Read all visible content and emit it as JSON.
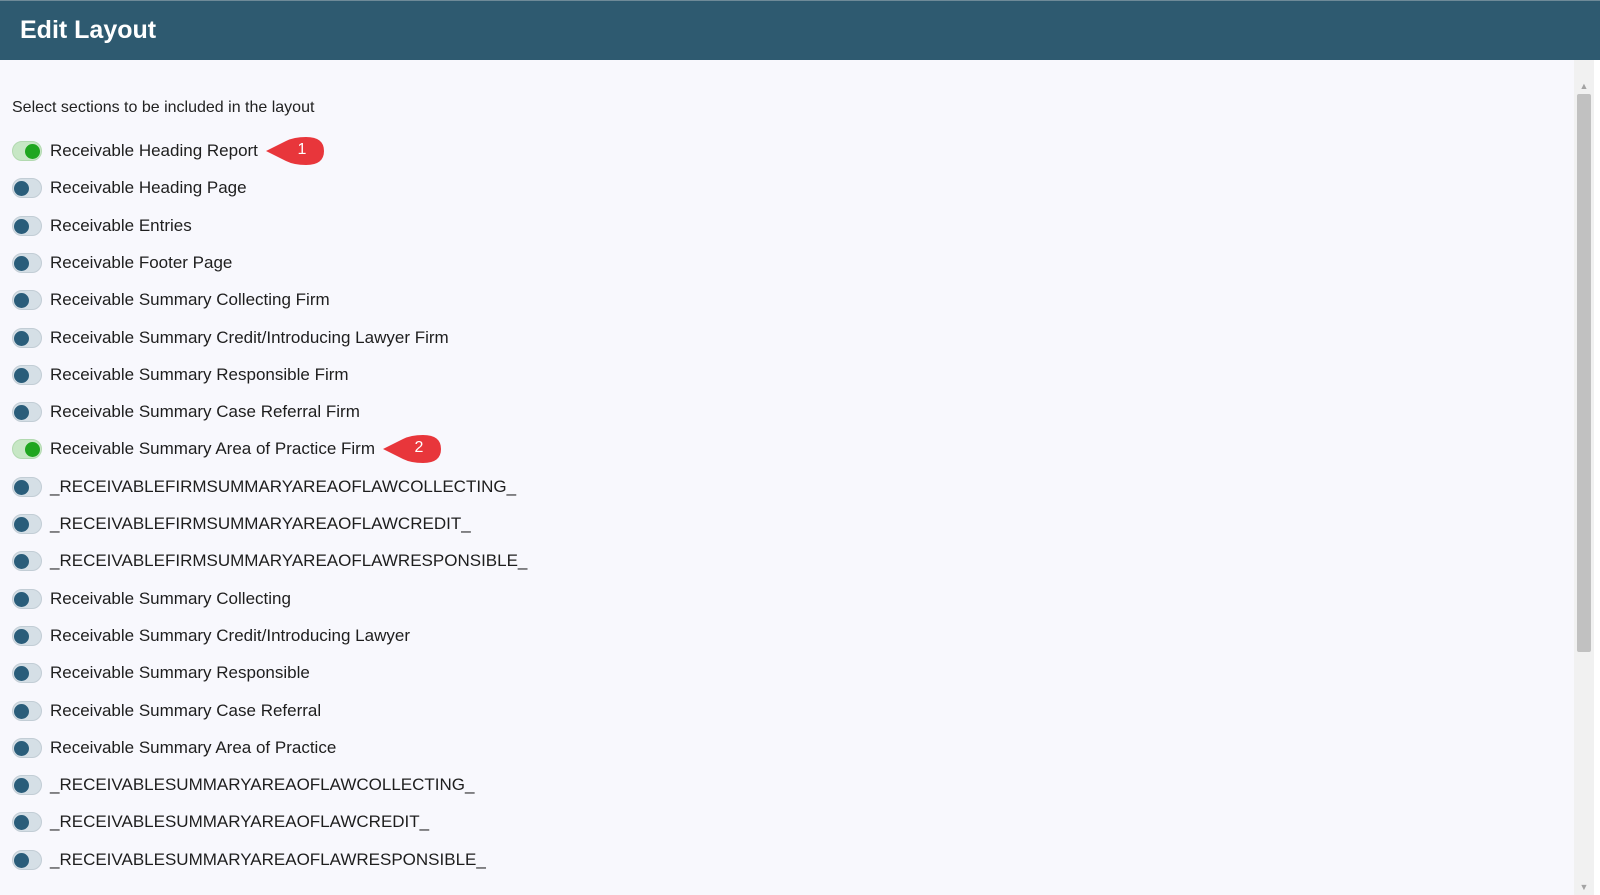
{
  "header": {
    "title": "Edit Layout"
  },
  "instruction": "Select sections to be included in the layout",
  "sections": [
    {
      "label": "Receivable Heading Report",
      "enabled": true
    },
    {
      "label": "Receivable Heading Page",
      "enabled": false
    },
    {
      "label": "Receivable Entries",
      "enabled": false
    },
    {
      "label": "Receivable Footer Page",
      "enabled": false
    },
    {
      "label": "Receivable Summary Collecting Firm",
      "enabled": false
    },
    {
      "label": "Receivable Summary Credit/Introducing Lawyer Firm",
      "enabled": false
    },
    {
      "label": "Receivable Summary Responsible Firm",
      "enabled": false
    },
    {
      "label": "Receivable Summary Case Referral Firm",
      "enabled": false
    },
    {
      "label": "Receivable Summary Area of Practice Firm",
      "enabled": true
    },
    {
      "label": "_RECEIVABLEFIRMSUMMARYAREAOFLAWCOLLECTING_",
      "enabled": false
    },
    {
      "label": "_RECEIVABLEFIRMSUMMARYAREAOFLAWCREDIT_",
      "enabled": false
    },
    {
      "label": "_RECEIVABLEFIRMSUMMARYAREAOFLAWRESPONSIBLE_",
      "enabled": false
    },
    {
      "label": "Receivable Summary Collecting",
      "enabled": false
    },
    {
      "label": "Receivable Summary Credit/Introducing Lawyer",
      "enabled": false
    },
    {
      "label": "Receivable Summary Responsible",
      "enabled": false
    },
    {
      "label": "Receivable Summary Case Referral",
      "enabled": false
    },
    {
      "label": "Receivable Summary Area of Practice",
      "enabled": false
    },
    {
      "label": "_RECEIVABLESUMMARYAREAOFLAWCOLLECTING_",
      "enabled": false
    },
    {
      "label": "_RECEIVABLESUMMARYAREAOFLAWCREDIT_",
      "enabled": false
    },
    {
      "label": "_RECEIVABLESUMMARYAREAOFLAWRESPONSIBLE_",
      "enabled": false
    }
  ],
  "callouts": [
    {
      "number": "1",
      "row_index": 0
    },
    {
      "number": "2",
      "row_index": 8
    }
  ],
  "colors": {
    "header_bg": "#2e5a70",
    "toggle_on": "#1fa61f",
    "toggle_off": "#2a5d7a",
    "callout": "#e8363b"
  },
  "icons": {
    "scroll_up": "chevron-up-icon",
    "scroll_down": "chevron-down-icon"
  }
}
